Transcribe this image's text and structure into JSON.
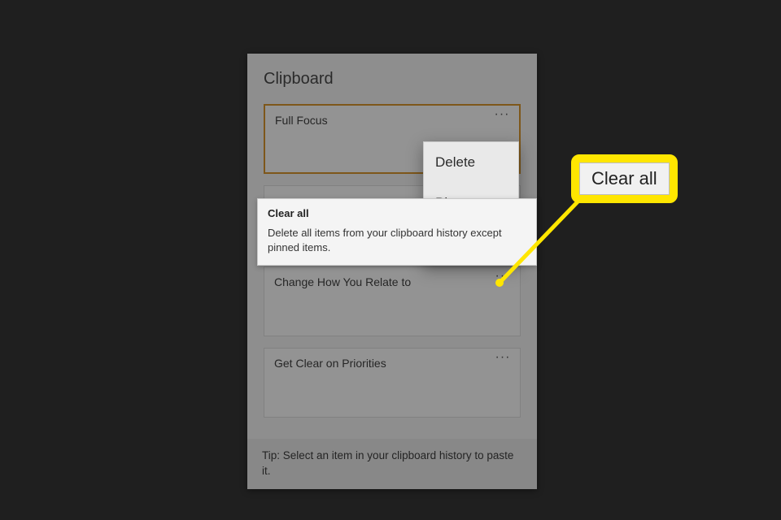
{
  "panel": {
    "title": "Clipboard",
    "tip": "Tip: Select an item in your clipboard history to paste it."
  },
  "items": [
    {
      "text": "Full Focus"
    },
    {
      "text": ""
    },
    {
      "text": "Change How You Relate to"
    },
    {
      "text": "Get Clear on Priorities"
    }
  ],
  "contextMenu": {
    "delete": "Delete",
    "pin": "Pin",
    "clearAll": "Clear all"
  },
  "tooltip": {
    "title": "Clear all",
    "body": "Delete all items from your clipboard history except pinned items."
  },
  "callout": {
    "label": "Clear all"
  },
  "icons": {
    "more": "···"
  }
}
